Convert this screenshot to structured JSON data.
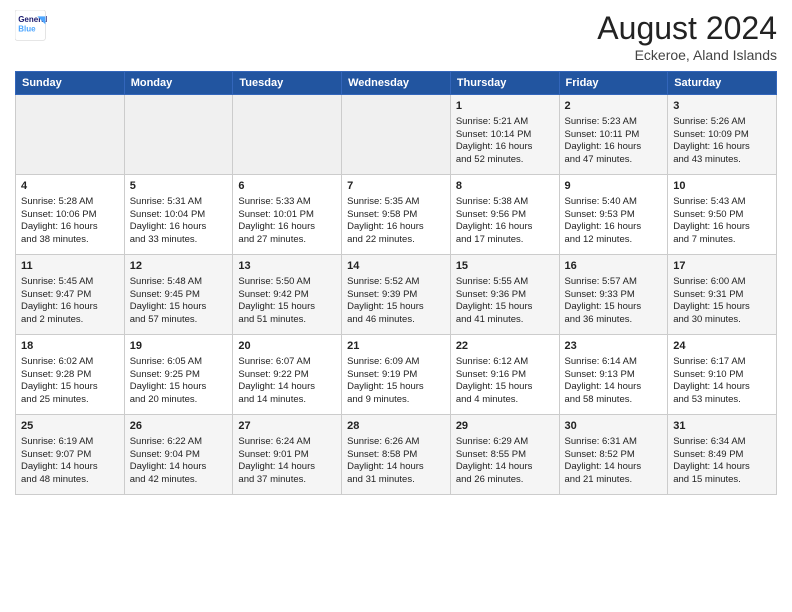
{
  "logo": {
    "line1": "General",
    "line2": "Blue"
  },
  "title": "August 2024",
  "subtitle": "Eckeroe, Aland Islands",
  "days_of_week": [
    "Sunday",
    "Monday",
    "Tuesday",
    "Wednesday",
    "Thursday",
    "Friday",
    "Saturday"
  ],
  "weeks": [
    [
      {
        "day": "",
        "content": ""
      },
      {
        "day": "",
        "content": ""
      },
      {
        "day": "",
        "content": ""
      },
      {
        "day": "",
        "content": ""
      },
      {
        "day": "1",
        "content": "Sunrise: 5:21 AM\nSunset: 10:14 PM\nDaylight: 16 hours\nand 52 minutes."
      },
      {
        "day": "2",
        "content": "Sunrise: 5:23 AM\nSunset: 10:11 PM\nDaylight: 16 hours\nand 47 minutes."
      },
      {
        "day": "3",
        "content": "Sunrise: 5:26 AM\nSunset: 10:09 PM\nDaylight: 16 hours\nand 43 minutes."
      }
    ],
    [
      {
        "day": "4",
        "content": "Sunrise: 5:28 AM\nSunset: 10:06 PM\nDaylight: 16 hours\nand 38 minutes."
      },
      {
        "day": "5",
        "content": "Sunrise: 5:31 AM\nSunset: 10:04 PM\nDaylight: 16 hours\nand 33 minutes."
      },
      {
        "day": "6",
        "content": "Sunrise: 5:33 AM\nSunset: 10:01 PM\nDaylight: 16 hours\nand 27 minutes."
      },
      {
        "day": "7",
        "content": "Sunrise: 5:35 AM\nSunset: 9:58 PM\nDaylight: 16 hours\nand 22 minutes."
      },
      {
        "day": "8",
        "content": "Sunrise: 5:38 AM\nSunset: 9:56 PM\nDaylight: 16 hours\nand 17 minutes."
      },
      {
        "day": "9",
        "content": "Sunrise: 5:40 AM\nSunset: 9:53 PM\nDaylight: 16 hours\nand 12 minutes."
      },
      {
        "day": "10",
        "content": "Sunrise: 5:43 AM\nSunset: 9:50 PM\nDaylight: 16 hours\nand 7 minutes."
      }
    ],
    [
      {
        "day": "11",
        "content": "Sunrise: 5:45 AM\nSunset: 9:47 PM\nDaylight: 16 hours\nand 2 minutes."
      },
      {
        "day": "12",
        "content": "Sunrise: 5:48 AM\nSunset: 9:45 PM\nDaylight: 15 hours\nand 57 minutes."
      },
      {
        "day": "13",
        "content": "Sunrise: 5:50 AM\nSunset: 9:42 PM\nDaylight: 15 hours\nand 51 minutes."
      },
      {
        "day": "14",
        "content": "Sunrise: 5:52 AM\nSunset: 9:39 PM\nDaylight: 15 hours\nand 46 minutes."
      },
      {
        "day": "15",
        "content": "Sunrise: 5:55 AM\nSunset: 9:36 PM\nDaylight: 15 hours\nand 41 minutes."
      },
      {
        "day": "16",
        "content": "Sunrise: 5:57 AM\nSunset: 9:33 PM\nDaylight: 15 hours\nand 36 minutes."
      },
      {
        "day": "17",
        "content": "Sunrise: 6:00 AM\nSunset: 9:31 PM\nDaylight: 15 hours\nand 30 minutes."
      }
    ],
    [
      {
        "day": "18",
        "content": "Sunrise: 6:02 AM\nSunset: 9:28 PM\nDaylight: 15 hours\nand 25 minutes."
      },
      {
        "day": "19",
        "content": "Sunrise: 6:05 AM\nSunset: 9:25 PM\nDaylight: 15 hours\nand 20 minutes."
      },
      {
        "day": "20",
        "content": "Sunrise: 6:07 AM\nSunset: 9:22 PM\nDaylight: 14 hours\nand 14 minutes."
      },
      {
        "day": "21",
        "content": "Sunrise: 6:09 AM\nSunset: 9:19 PM\nDaylight: 15 hours\nand 9 minutes."
      },
      {
        "day": "22",
        "content": "Sunrise: 6:12 AM\nSunset: 9:16 PM\nDaylight: 15 hours\nand 4 minutes."
      },
      {
        "day": "23",
        "content": "Sunrise: 6:14 AM\nSunset: 9:13 PM\nDaylight: 14 hours\nand 58 minutes."
      },
      {
        "day": "24",
        "content": "Sunrise: 6:17 AM\nSunset: 9:10 PM\nDaylight: 14 hours\nand 53 minutes."
      }
    ],
    [
      {
        "day": "25",
        "content": "Sunrise: 6:19 AM\nSunset: 9:07 PM\nDaylight: 14 hours\nand 48 minutes."
      },
      {
        "day": "26",
        "content": "Sunrise: 6:22 AM\nSunset: 9:04 PM\nDaylight: 14 hours\nand 42 minutes."
      },
      {
        "day": "27",
        "content": "Sunrise: 6:24 AM\nSunset: 9:01 PM\nDaylight: 14 hours\nand 37 minutes."
      },
      {
        "day": "28",
        "content": "Sunrise: 6:26 AM\nSunset: 8:58 PM\nDaylight: 14 hours\nand 31 minutes."
      },
      {
        "day": "29",
        "content": "Sunrise: 6:29 AM\nSunset: 8:55 PM\nDaylight: 14 hours\nand 26 minutes."
      },
      {
        "day": "30",
        "content": "Sunrise: 6:31 AM\nSunset: 8:52 PM\nDaylight: 14 hours\nand 21 minutes."
      },
      {
        "day": "31",
        "content": "Sunrise: 6:34 AM\nSunset: 8:49 PM\nDaylight: 14 hours\nand 15 minutes."
      }
    ]
  ]
}
